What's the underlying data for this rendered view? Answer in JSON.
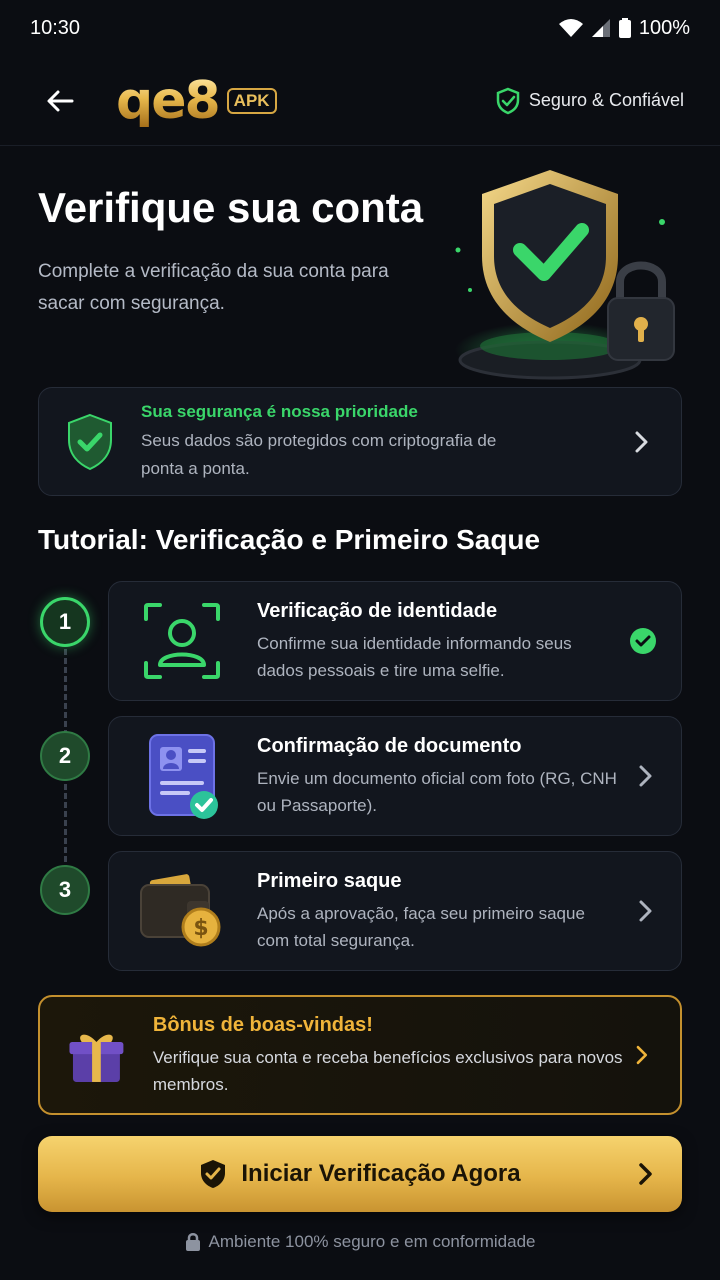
{
  "status_bar": {
    "time": "10:30",
    "battery": "100%"
  },
  "app_bar": {
    "logo_text": "qe8",
    "logo_badge": "APK",
    "trust_label": "Seguro & Confiável"
  },
  "hero": {
    "title": "Verifique sua conta",
    "subtitle": "Complete a verificação da sua conta para sacar com segurança."
  },
  "security_card": {
    "title": "Sua segurança é nossa prioridade",
    "description": "Seus dados são protegidos com criptografia de ponta a ponta."
  },
  "tutorial": {
    "title": "Tutorial: Verificação e Primeiro Saque",
    "steps": [
      {
        "number": "1",
        "title": "Verificação de identidade",
        "description": "Confirme sua identidade informando seus dados pessoais e tire uma selfie.",
        "status": "completed"
      },
      {
        "number": "2",
        "title": "Confirmação de documento",
        "description": "Envie um documento oficial com foto (RG, CNH ou Passaporte).",
        "status": "pending"
      },
      {
        "number": "3",
        "title": "Primeiro saque",
        "description": "Após a aprovação, faça seu primeiro saque com total segurança.",
        "status": "pending"
      }
    ]
  },
  "bonus": {
    "title": "Bônus de boas-vindas!",
    "description": "Verifique sua conta e receba benefícios exclusivos para novos membros."
  },
  "cta": {
    "label": "Iniciar Verificação Agora"
  },
  "footer": {
    "text": "Ambiente 100% seguro e em conformidade"
  },
  "colors": {
    "accent_green": "#3ad66a",
    "accent_gold": "#e5b54a",
    "background": "#0b0d12"
  },
  "icons": [
    "wifi-icon",
    "signal-icon",
    "battery-icon",
    "back-arrow-icon",
    "shield-check-icon",
    "padlock-icon",
    "face-scan-icon",
    "id-document-icon",
    "wallet-icon",
    "gift-icon",
    "chevron-right-icon",
    "check-circle-icon"
  ]
}
